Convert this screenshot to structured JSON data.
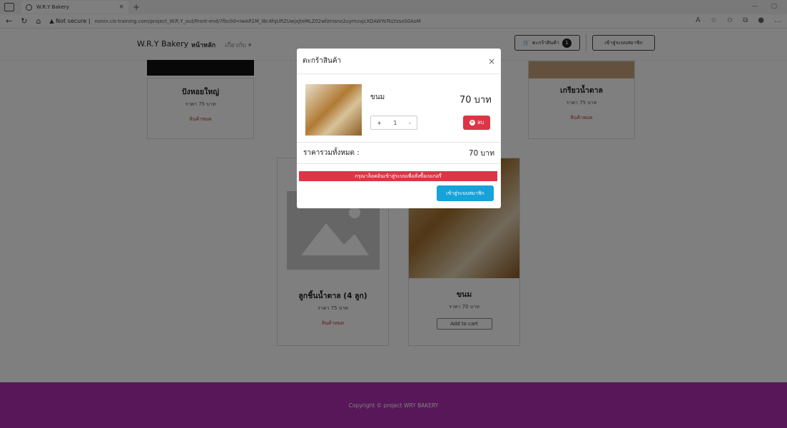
{
  "browser": {
    "tab_title": "W.R.Y Bakery",
    "security_label": "Not secure",
    "url": "nonin.cis-training.com/project_W.R.Y_out/Front-end/?fbclid=IwAR1M_I8c4fqURZUwjxJteMLZ02wfzmsno2uymuvjcXDAWYoTsLYzsoS0AoM"
  },
  "navbar": {
    "brand": "W.R.Y Bakery",
    "home": "หน้าหลัก",
    "about": "เกี่ยวกับ",
    "cart_label": "ตะกร้าสินค้า",
    "cart_count": "1",
    "login": "เข้าสู่ระบบสมาชิก"
  },
  "products": [
    {
      "name": "ปังหอยใหญ่",
      "price": "ราคา 75 บาท",
      "status": "สินค้าหมด"
    },
    {
      "name": "เกรียวน้ำตาล",
      "price": "ราคา 75 บาท",
      "status": "สินค้าหมด"
    },
    {
      "name": "ลูกชิ้นน้ำตาล (4 ลูก)",
      "price": "ราคา 75 บาท",
      "status": "สินค้าหมด"
    },
    {
      "name": "ขนม",
      "price": "ราคา 70 บาท",
      "action": "Add to cart"
    }
  ],
  "footer": {
    "text": "Copyright © project WRY BAKERY"
  },
  "modal": {
    "title": "ตะกร้าสินค้า",
    "close": "×",
    "item_name": "ขนม",
    "item_price": "70 บาท",
    "qty_minus": "+",
    "qty": "1",
    "qty_plus": "-",
    "delete": "ลบ",
    "total_label": "ราคารวมทั้งหมด :",
    "total_value": "70 บาท",
    "alert": "กรุณาล็อคอินเข้าสู่ระบบเพื่อสั่งซื้อเบเกอรี่",
    "member_button": "เข้าสู่ระบบสมาชิก"
  },
  "colors": {
    "footer": "#b12fb1",
    "danger": "#dc3545",
    "info": "#17a2d9"
  }
}
